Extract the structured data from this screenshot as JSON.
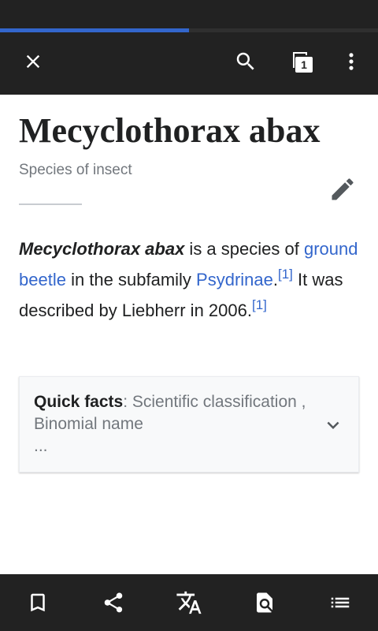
{
  "page_progress": 0.5,
  "toolbar": {
    "close_icon": "close-icon",
    "search_icon": "search-icon",
    "tabs_icon": "tabs-icon",
    "tab_count": "1",
    "menu_icon": "overflow-menu-icon"
  },
  "article": {
    "title": "Mecyclothorax abax",
    "description": "Species of insect",
    "edit_icon": "pencil-icon",
    "paragraph": {
      "subject": "Mecyclothorax abax",
      "text1": " is a species of ",
      "link1": "ground beetle",
      "text2": " in the subfamily ",
      "link2": "Psydrinae",
      "text3": ".",
      "ref1": "[1]",
      "text4": " It was described by Liebherr in 2006.",
      "ref2": "[1]"
    }
  },
  "quick_facts": {
    "label": "Quick facts",
    "summary": ": Scientific classification , Binomial name",
    "ellipsis": "...",
    "expand_icon": "chevron-down-icon"
  },
  "bottom_bar": {
    "items": [
      "bookmark-icon",
      "share-icon",
      "translate-icon",
      "find-in-page-icon",
      "contents-icon"
    ]
  },
  "colors": {
    "toolbar_bg": "#222222",
    "link": "#3366cc",
    "text": "#202122",
    "secondary_text": "#72777d"
  }
}
